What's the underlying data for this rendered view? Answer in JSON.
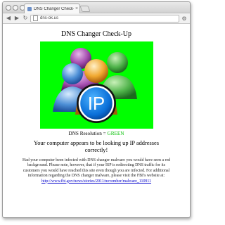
{
  "browser": {
    "tab_title": "DNS Changer Check-Up",
    "tab_close": "×",
    "address": "dns-ok.us",
    "back_icon": "back-arrow-icon",
    "forward_icon": "forward-arrow-icon",
    "reload_icon": "reload-icon",
    "menu_icon": "wrench-icon"
  },
  "page": {
    "title": "DNS Changer Check-Up",
    "logo_text": "IP",
    "dns_label": "DNS Resolution = ",
    "dns_value": "GREEN",
    "headline": "Your computer appears to be looking up IP addresses correctly!",
    "body": "Had your computer been infected with DNS changer malware you would have seen a red background.  Please note, however, that if your ISP is redirecting DNS traffic for its customers you would have reached this site even though you are infected. For additional information regarding the DNS changer malware, please visit the FBI's website at:",
    "link": "http://www.fbi.gov/news/stories/2011/november/malware_110911"
  },
  "colors": {
    "status_background": "#00ff00",
    "status_text": "#00c000",
    "link": "#0000cc"
  }
}
